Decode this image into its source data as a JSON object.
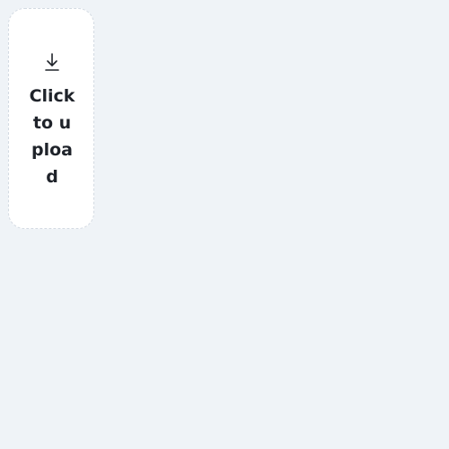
{
  "upload": {
    "label": "Click to upload",
    "icon": "download-arrow-icon",
    "background": "#ffffff",
    "border": "#d3dae2",
    "text_color": "#1f232a"
  },
  "page": {
    "background": "#eff3f7"
  }
}
